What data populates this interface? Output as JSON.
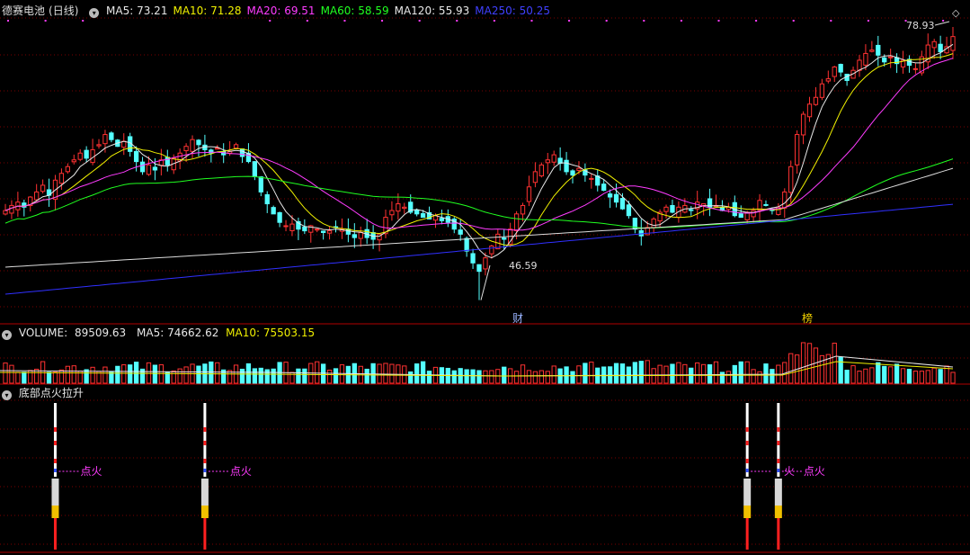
{
  "stock": {
    "name": "德赛电池",
    "period": "(日线)"
  },
  "ma_legend": [
    {
      "label": "MA5: ",
      "value": "73.21",
      "color": "#e8e8e8"
    },
    {
      "label": "MA10: ",
      "value": "71.28",
      "color": "#f0f000"
    },
    {
      "label": "MA20: ",
      "value": "69.51",
      "color": "#ff3cff"
    },
    {
      "label": "MA60: ",
      "value": "58.59",
      "color": "#20ff20"
    },
    {
      "label": "MA120: ",
      "value": "55.93",
      "color": "#e8e8e8"
    },
    {
      "label": "MA250: ",
      "value": "50.25",
      "color": "#4040ff"
    }
  ],
  "volume_legend": {
    "label": "VOLUME: ",
    "value": "89509.63",
    "ma5": "MA5: 74662.62",
    "ma10": "MA10: 75503.15"
  },
  "indicator": {
    "name": "底部点火拉升",
    "signal_label": "点火",
    "extra_label": "火"
  },
  "markers": {
    "high": "78.93",
    "low": "46.59",
    "event1": "财",
    "event2": "榜"
  },
  "colors": {
    "up": "#ff3232",
    "down": "#54ffff",
    "ma5": "#e8e8e8",
    "ma10": "#f0f000",
    "ma20": "#ff3cff",
    "ma60": "#20ff20",
    "ma120": "#dcdcdc",
    "ma250": "#3030ff",
    "grid": "#7a0000"
  },
  "chart_data": {
    "type": "candlestick",
    "y_range": [
      44,
      80
    ],
    "high": 78.93,
    "low": 46.59,
    "closes": [
      57.2,
      57.8,
      58.2,
      57.6,
      58.8,
      59.4,
      60.2,
      59.0,
      60.8,
      61.6,
      62.4,
      63.2,
      64.0,
      63.4,
      64.4,
      65.0,
      66.2,
      65.6,
      64.8,
      65.4,
      64.2,
      63.0,
      61.8,
      62.6,
      62.0,
      63.2,
      62.6,
      63.4,
      64.0,
      64.8,
      65.6,
      65.0,
      64.4,
      64.0,
      64.6,
      63.8,
      64.2,
      65.0,
      63.6,
      63.0,
      61.2,
      59.4,
      58.0,
      56.8,
      55.8,
      55.4,
      55.6,
      55.0,
      54.8,
      55.4,
      55.0,
      54.6,
      54.8,
      55.2,
      55.0,
      54.4,
      54.0,
      54.6,
      54.0,
      53.8,
      54.4,
      56.4,
      57.2,
      58.0,
      57.6,
      57.0,
      56.8,
      56.4,
      56.2,
      56.6,
      56.0,
      55.8,
      55.0,
      54.4,
      52.4,
      51.0,
      50.0,
      51.6,
      53.0,
      54.4,
      53.8,
      55.0,
      56.8,
      57.8,
      60.0,
      61.8,
      62.6,
      63.2,
      63.8,
      62.8,
      61.8,
      61.4,
      62.2,
      61.4,
      61.0,
      60.2,
      59.6,
      58.8,
      58.2,
      57.4,
      56.6,
      55.0,
      54.2,
      55.2,
      56.2,
      57.0,
      57.6,
      57.0,
      57.6,
      57.8,
      57.2,
      58.2,
      58.0,
      57.6,
      57.8,
      57.2,
      57.6,
      56.6,
      56.4,
      57.0,
      57.2,
      58.4,
      57.8,
      57.2,
      57.6,
      59.4,
      62.4,
      66.2,
      68.6,
      69.8,
      70.6,
      72.2,
      72.8,
      74.2,
      73.6,
      72.6,
      73.8,
      75.0,
      75.8,
      76.2,
      75.6,
      74.8,
      75.4,
      74.6,
      75.0,
      74.4,
      74.0,
      75.4,
      76.8,
      77.2,
      76.0,
      76.6,
      77.8
    ],
    "moving_averages": {
      "MA5": 73.21,
      "MA10": 71.28,
      "MA20": 69.51,
      "MA60": 58.59,
      "MA120": 55.93,
      "MA250": 50.25
    },
    "volume": {
      "latest": 89509.63,
      "MA5": 74662.62,
      "MA10": 75503.15
    },
    "indicator_signals_at_index": [
      8,
      32,
      119,
      124
    ]
  }
}
